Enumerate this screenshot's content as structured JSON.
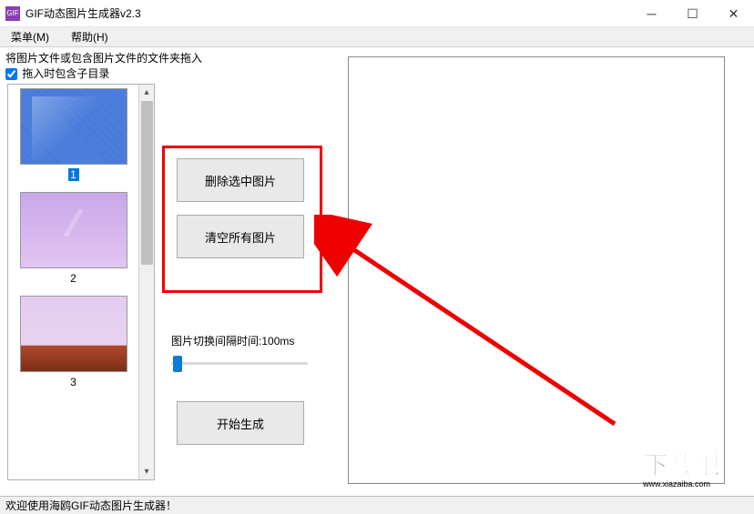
{
  "window": {
    "title": "GIF动态图片生成器v2.3"
  },
  "menu": {
    "items": [
      "菜单(M)",
      "帮助(H)"
    ]
  },
  "labels": {
    "drag_hint": "将图片文件或包含图片文件的文件夹拖入",
    "include_subdirs": "拖入时包含子目录"
  },
  "thumbnails": [
    {
      "label": "1",
      "selected": true
    },
    {
      "label": "2",
      "selected": false
    },
    {
      "label": "3",
      "selected": false
    }
  ],
  "buttons": {
    "delete_selected": "删除选中图片",
    "clear_all": "清空所有图片",
    "start_generate": "开始生成"
  },
  "interval": {
    "label_prefix": "图片切换间隔时间:",
    "value": "100ms"
  },
  "status": {
    "text": "欢迎使用海鸥GIF动态图片生成器！"
  },
  "watermark": {
    "text": "下载吧",
    "url": "www.xiazaiba.com"
  }
}
